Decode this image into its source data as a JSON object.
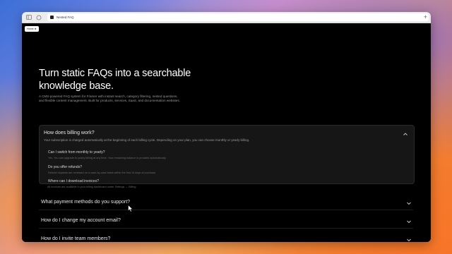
{
  "browser": {
    "tab_title": "Nested FAQ"
  },
  "page": {
    "home_button": "Home ⊕",
    "hero_title": "Turn static FAQs into a searchable knowledge base.",
    "hero_subtitle": "A CMS-powered FAQ system for Framer with instant search, category filtering, nested questions, and flexible content management. Built for products, services, SaaS, and documentation websites."
  },
  "faq": {
    "open_item": {
      "question": "How does billing work?",
      "answer": "Your subscription is charged automatically at the beginning of each billing cycle. Depending on your plan, you can choose monthly or yearly billing.",
      "children": [
        {
          "question": "Can I switch from monthly to yearly?",
          "answer": "Yes. You can upgrade to yearly billing at any time. Your remaining balance is prorated automatically."
        },
        {
          "question": "Do you offer refunds?",
          "answer": "Refund requests are reviewed on a case-by-case basis within the first 14 days of purchase."
        },
        {
          "question": "Where can I download invoices?",
          "answer": "All invoices are available in your billing dashboard under Settings → Billing."
        }
      ]
    },
    "collapsed_items": [
      {
        "question": "What payment methods do you support?"
      },
      {
        "question": "How do I change my account email?"
      },
      {
        "question": "How do I invite team members?"
      }
    ]
  }
}
